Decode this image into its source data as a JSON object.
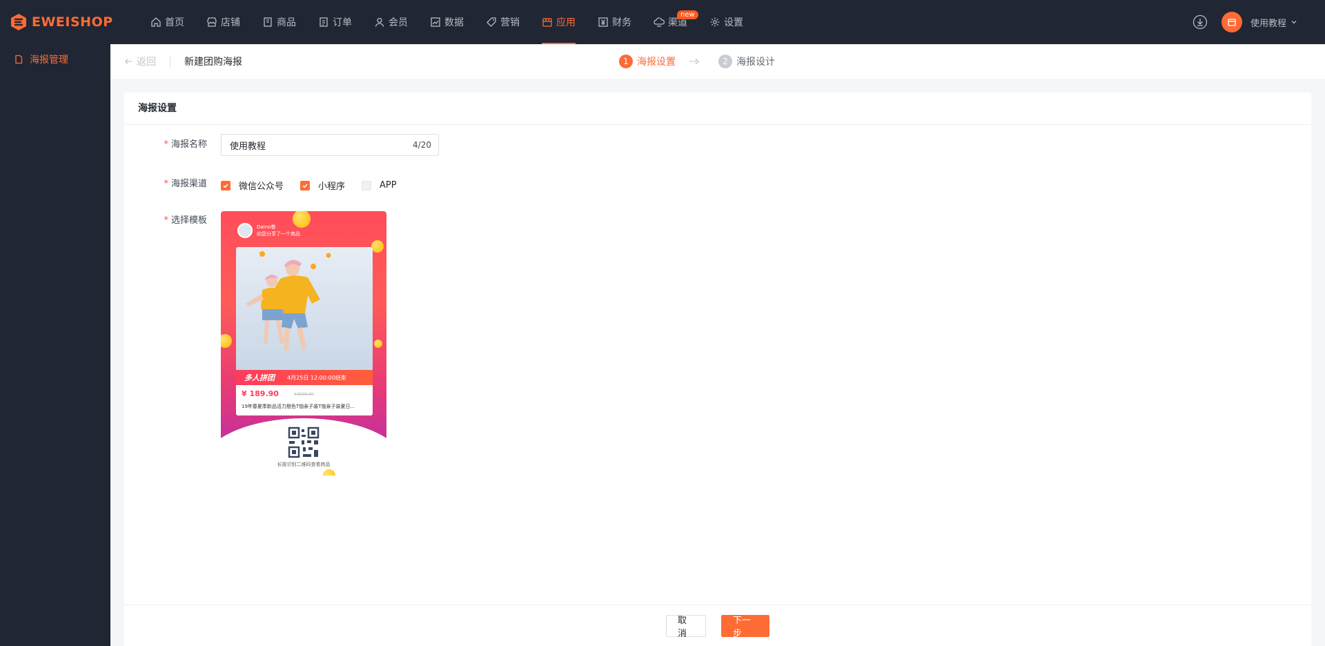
{
  "brand": {
    "name": "EWEISHOP",
    "accent": "#ff6b35"
  },
  "nav": {
    "items": [
      {
        "label": "首页",
        "icon": "home-icon"
      },
      {
        "label": "店铺",
        "icon": "store-icon"
      },
      {
        "label": "商品",
        "icon": "goods-icon"
      },
      {
        "label": "订单",
        "icon": "order-icon"
      },
      {
        "label": "会员",
        "icon": "member-icon"
      },
      {
        "label": "数据",
        "icon": "chart-icon"
      },
      {
        "label": "营销",
        "icon": "tag-icon"
      },
      {
        "label": "应用",
        "icon": "app-icon",
        "active": true
      },
      {
        "label": "财务",
        "icon": "finance-icon"
      },
      {
        "label": "渠道",
        "icon": "channel-icon",
        "badge": "new"
      },
      {
        "label": "设置",
        "icon": "gear-icon"
      }
    ]
  },
  "user": {
    "name": "使用教程"
  },
  "sidebar": {
    "items": [
      {
        "label": "海报管理",
        "icon": "poster-icon",
        "active": true
      }
    ]
  },
  "header": {
    "back_label": "返回",
    "title": "新建团购海报",
    "steps": [
      {
        "num": "1",
        "label": "海报设置",
        "active": true
      },
      {
        "num": "2",
        "label": "海报设计",
        "active": false
      }
    ]
  },
  "card": {
    "title": "海报设置",
    "name_field": {
      "label": "海报名称",
      "value": "使用教程",
      "count": "4/20"
    },
    "channel_field": {
      "label": "海报渠道",
      "options": [
        {
          "label": "微信公众号",
          "checked": true
        },
        {
          "label": "小程序",
          "checked": true
        },
        {
          "label": "APP",
          "checked": false
        }
      ]
    },
    "template_field": {
      "label": "选择模板"
    }
  },
  "poster": {
    "user_name": "Daino巷",
    "user_sub": "向您分享了一个商品",
    "banner_title": "多人拼团",
    "banner_time": "4月25日 12:00:00结束",
    "price": "¥ 189.90",
    "old_price": "¥3999.00",
    "desc": "19年春夏季新品活力橙色T恤亲子装T恤亲子装夏日...",
    "qr_text": "长按识别二维码查看商品"
  },
  "footer": {
    "cancel_label": "取消",
    "next_label": "下一步"
  }
}
